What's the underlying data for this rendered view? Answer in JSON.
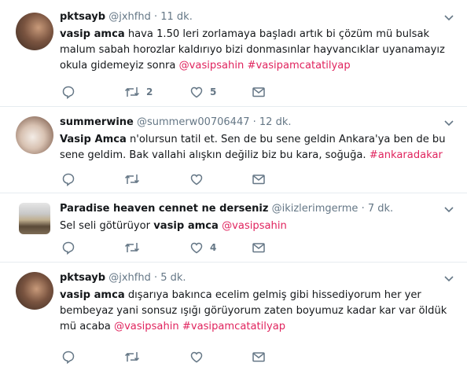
{
  "tweets": [
    {
      "name": "pktsayb",
      "handle": "@jxhfhd",
      "time": "11 dk.",
      "text_parts": [
        {
          "t": "vasip amca",
          "bold": true
        },
        {
          "t": " hava 1.50 leri zorlamaya başladı artık bi çözüm mü bulsak malum sabah horozlar kaldırıyo bizi donmasınlar hayvancıklar uyanamayız okula gidemeyiz sonra "
        },
        {
          "t": "@vasipsahin",
          "link": true
        },
        {
          "t": " "
        },
        {
          "t": "#vasipamcatatilyap",
          "link": true
        }
      ],
      "retweets": "2",
      "likes": "5"
    },
    {
      "name": "summerwine",
      "handle": "@summerw00706447",
      "time": "12 dk.",
      "text_parts": [
        {
          "t": "Vasip Amca",
          "bold": true
        },
        {
          "t": " n'olursun tatil et. Sen de bu sene geldin Ankara'ya ben de bu sene geldim. Bak vallahi alışkın değiliz biz bu kara, soğuğa. "
        },
        {
          "t": "#ankaradakar",
          "link": true
        }
      ],
      "retweets": "",
      "likes": ""
    },
    {
      "name": "Paradise heaven cennet ne derseniz",
      "handle": "@ikizlerimgerme",
      "time": "7 dk.",
      "text_parts": [
        {
          "t": "Sel seli götürüyor "
        },
        {
          "t": "vasip amca",
          "bold": true
        },
        {
          "t": " "
        },
        {
          "t": "@vasipsahin",
          "link": true
        }
      ],
      "retweets": "",
      "likes": "4"
    },
    {
      "name": "pktsayb",
      "handle": "@jxhfhd",
      "time": "5 dk.",
      "text_parts": [
        {
          "t": "vasip amca",
          "bold": true
        },
        {
          "t": " dışarıya bakınca ecelim gelmiş gibi hissediyorum her yer bembeyaz yani sonsuz ışığı görüyorum zaten boyumuz kadar kar var öldük mü acaba "
        },
        {
          "t": "@vasipsahin",
          "link": true
        },
        {
          "t": " "
        },
        {
          "t": "#vasipamcatatilyap",
          "link": true
        }
      ],
      "retweets": "",
      "likes": ""
    }
  ],
  "separator": "·",
  "colors": {
    "link": "#e0245e",
    "muted": "#657786",
    "border": "#e6ecf0"
  },
  "icons": [
    "reply-icon",
    "retweet-icon",
    "like-icon",
    "message-icon",
    "chevron-down-icon"
  ]
}
